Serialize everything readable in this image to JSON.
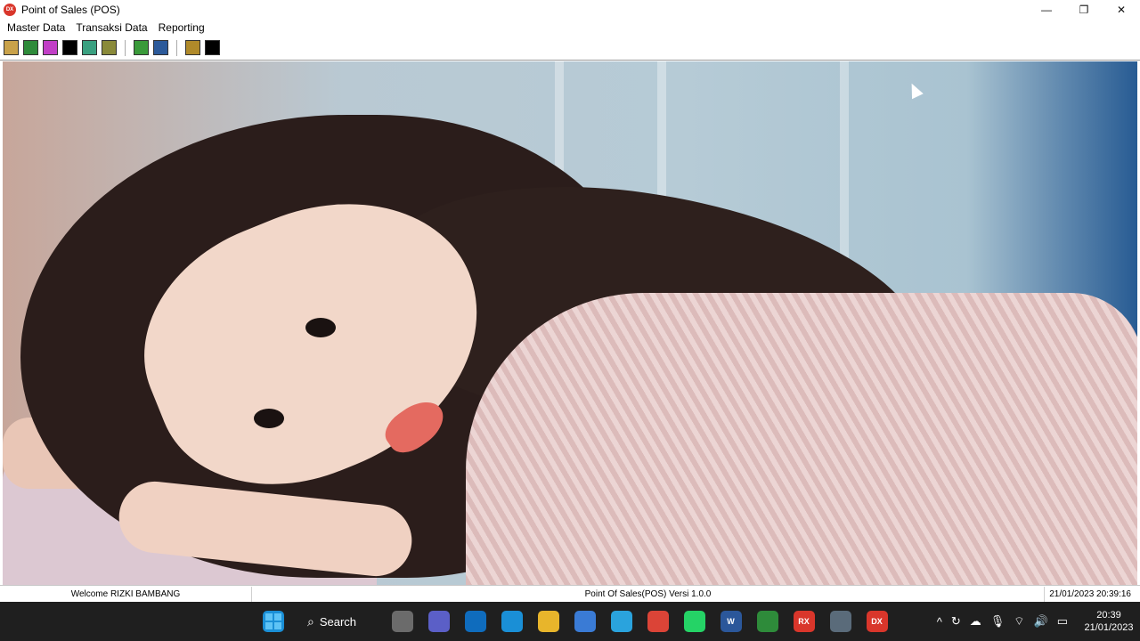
{
  "window": {
    "title": "Point of Sales (POS)",
    "app_icon_label": "DX",
    "controls": {
      "minimize": "—",
      "restore": "❐",
      "close": "✕"
    }
  },
  "menu": {
    "items": [
      {
        "label": "Master Data"
      },
      {
        "label": "Transaksi Data"
      },
      {
        "label": "Reporting"
      }
    ]
  },
  "toolbar": {
    "buttons": [
      {
        "icon": "tag-icon",
        "color": "#c9a24a"
      },
      {
        "icon": "arrow-icon",
        "color": "#2e8b3a"
      },
      {
        "icon": "eraser-icon",
        "color": "#c13fc6"
      },
      {
        "icon": "blank-icon",
        "color": "#000000"
      },
      {
        "icon": "network-icon",
        "color": "#3aa080"
      },
      {
        "icon": "users-icon",
        "color": "#8a8a3a"
      },
      {
        "icon": "gear-icon",
        "color": "#3a9a3a"
      },
      {
        "icon": "building-icon",
        "color": "#2c5a9a"
      },
      {
        "icon": "report-icon",
        "color": "#b08a2a"
      },
      {
        "icon": "blank-icon",
        "color": "#000000"
      }
    ]
  },
  "statusbar": {
    "welcome": "Welcome RIZKI BAMBANG",
    "version": "Point Of Sales(POS) Versi 1.0.0",
    "datetime": "21/01/2023 20:39:16"
  },
  "taskbar": {
    "search_label": "Search",
    "apps": [
      {
        "name": "task-view",
        "color": "#6b6b6b",
        "text": ""
      },
      {
        "name": "teams",
        "color": "#5b5fc7",
        "text": ""
      },
      {
        "name": "mail",
        "color": "#0f6cbd",
        "text": ""
      },
      {
        "name": "edge",
        "color": "#1a8fd6",
        "text": ""
      },
      {
        "name": "file-explorer",
        "color": "#e8b52b",
        "text": ""
      },
      {
        "name": "store",
        "color": "#3a7bd5",
        "text": ""
      },
      {
        "name": "telegram",
        "color": "#2aa3dd",
        "text": ""
      },
      {
        "name": "chrome",
        "color": "#db4437",
        "text": ""
      },
      {
        "name": "whatsapp",
        "color": "#25d366",
        "text": ""
      },
      {
        "name": "word",
        "color": "#2b579a",
        "text": "W"
      },
      {
        "name": "excel-tool",
        "color": "#2e8b3a",
        "text": ""
      },
      {
        "name": "rx-app",
        "color": "#d9362b",
        "text": "RX"
      },
      {
        "name": "settings",
        "color": "#5a6b7a",
        "text": ""
      },
      {
        "name": "dx-app",
        "color": "#d9362b",
        "text": "DX"
      }
    ],
    "clock": {
      "time": "20:39",
      "date": "21/01/2023"
    }
  }
}
